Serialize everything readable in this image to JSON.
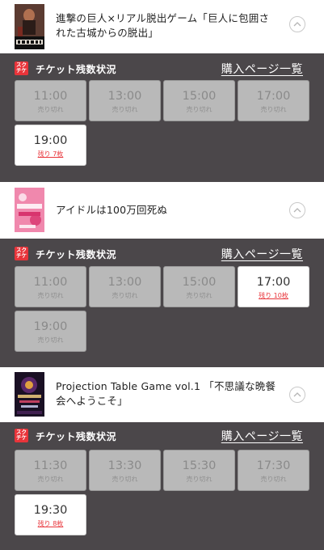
{
  "events": [
    {
      "title": "進撃の巨人×リアル脱出ゲーム「巨人に包囲された古城からの脱出」",
      "poster_text": "巨人に包囲された古城からの脱出",
      "panel": {
        "title": "チケット残数状況",
        "buy_link": "購入ページ一覧",
        "logo_text": "スク\nチケ",
        "slots": [
          {
            "time": "11:00",
            "status": "売り切れ",
            "available": false
          },
          {
            "time": "13:00",
            "status": "売り切れ",
            "available": false
          },
          {
            "time": "15:00",
            "status": "売り切れ",
            "available": false
          },
          {
            "time": "17:00",
            "status": "売り切れ",
            "available": false
          },
          {
            "time": "19:00",
            "status": "残り 7枚",
            "available": true
          }
        ]
      }
    },
    {
      "title": "アイドルは100万回死ぬ",
      "poster_text": "アイドルは100万回死ぬ",
      "panel": {
        "title": "チケット残数状況",
        "buy_link": "購入ページ一覧",
        "logo_text": "スク\nチケ",
        "slots": [
          {
            "time": "11:00",
            "status": "売り切れ",
            "available": false
          },
          {
            "time": "13:00",
            "status": "売り切れ",
            "available": false
          },
          {
            "time": "15:00",
            "status": "売り切れ",
            "available": false
          },
          {
            "time": "17:00",
            "status": "残り 10枚",
            "available": true
          },
          {
            "time": "19:00",
            "status": "売り切れ",
            "available": false
          }
        ]
      }
    },
    {
      "title": "Projection Table Game vol.1 「不思議な晩餐会へようこそ」",
      "poster_text": "不思議な晩餐会へようこそ",
      "panel": {
        "title": "チケット残数状況",
        "buy_link": "購入ページ一覧",
        "logo_text": "スク\nチケ",
        "slots": [
          {
            "time": "11:30",
            "status": "売り切れ",
            "available": false
          },
          {
            "time": "13:30",
            "status": "売り切れ",
            "available": false
          },
          {
            "time": "15:30",
            "status": "売り切れ",
            "available": false
          },
          {
            "time": "17:30",
            "status": "売り切れ",
            "available": false
          },
          {
            "time": "19:30",
            "status": "残り 8枚",
            "available": true
          }
        ]
      }
    }
  ],
  "colors": {
    "background": "#4b474a",
    "accent": "#e8343a",
    "soldout_tile": "#b9b9b9",
    "available_tile": "#ffffff"
  },
  "icons": {
    "expand": "chevron-up-icon",
    "logo": "sukuchike-logo-icon"
  }
}
